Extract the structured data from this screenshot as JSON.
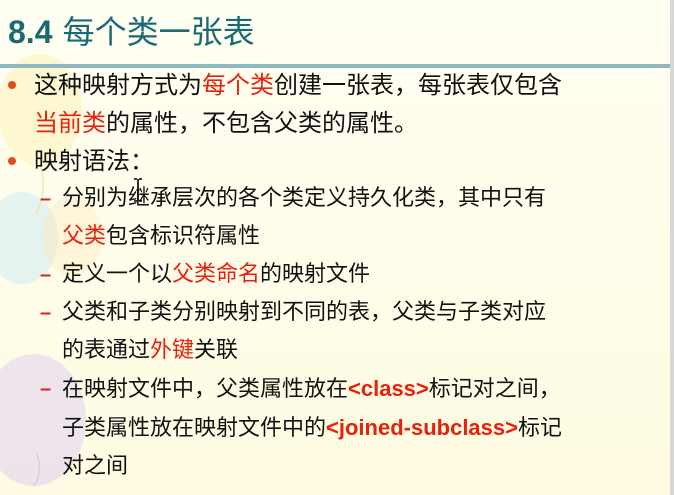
{
  "slide": {
    "title_num": "8.4",
    "title_text": " 每个类一张表",
    "bullets": [
      {
        "lines": [
          [
            {
              "t": "这种映射方式为",
              "red": false
            },
            {
              "t": "每个类",
              "red": true
            },
            {
              "t": "创建一张表，每张表仅包含",
              "red": false
            }
          ],
          [
            {
              "t": "当前类",
              "red": true
            },
            {
              "t": "的属性，不包含父类的属性。",
              "red": false
            }
          ]
        ]
      },
      {
        "lines": [
          [
            {
              "t": "映射语法：",
              "red": false
            }
          ]
        ],
        "subs": [
          {
            "lines": [
              [
                {
                  "t": "分别为继承层次的各个类定义持久化类，其中只有",
                  "red": false
                }
              ],
              [
                {
                  "t": "父类",
                  "red": true
                },
                {
                  "t": "包含标识符属性",
                  "red": false
                }
              ]
            ]
          },
          {
            "lines": [
              [
                {
                  "t": "定义一个以",
                  "red": false
                },
                {
                  "t": "父类命名",
                  "red": true
                },
                {
                  "t": "的映射文件",
                  "red": false
                }
              ]
            ]
          },
          {
            "lines": [
              [
                {
                  "t": "父类和子类分别映射到不同的表，父类与子类对应",
                  "red": false
                }
              ],
              [
                {
                  "t": "的表通过",
                  "red": false
                },
                {
                  "t": "外键",
                  "red": true
                },
                {
                  "t": "关联",
                  "red": false
                }
              ]
            ]
          },
          {
            "lines": [
              [
                {
                  "t": "在映射文件中，父类属性放在",
                  "red": false
                },
                {
                  "t": "<class>",
                  "tag": true
                },
                {
                  "t": "标记对之间，",
                  "red": false
                }
              ],
              [
                {
                  "t": "子类属性放在映射文件中的",
                  "red": false
                },
                {
                  "t": "<joined-subclass>",
                  "tag": true
                },
                {
                  "t": "标记",
                  "red": false
                }
              ],
              [
                {
                  "t": "对之间",
                  "red": false
                }
              ]
            ]
          }
        ]
      }
    ],
    "colors": {
      "title": "#1a6a74",
      "highlight": "#e8200c",
      "bullet": "#e24c1a"
    },
    "icons": {
      "cursor": "text-cursor-icon",
      "bullet": "bullet-dot-icon",
      "sub_bullet": "dash-icon"
    }
  }
}
